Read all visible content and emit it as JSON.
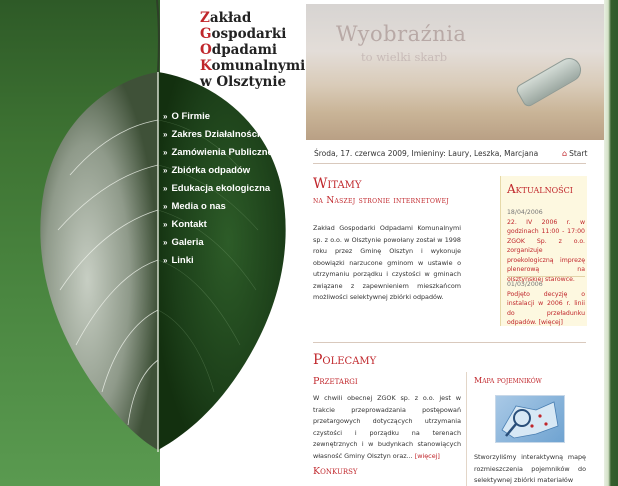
{
  "logo": {
    "lines": [
      {
        "cap": "Z",
        "rest": "akład"
      },
      {
        "cap": "G",
        "rest": "ospodarki"
      },
      {
        "cap": "O",
        "rest": "dpadami"
      },
      {
        "cap": "K",
        "rest": "omunalnymi"
      },
      {
        "cap": "",
        "rest": "w Olsztynie"
      }
    ]
  },
  "nav": {
    "items": [
      {
        "label": "O Firmie"
      },
      {
        "label": "Zakres Działalności"
      },
      {
        "label": "Zamówienia Publiczne"
      },
      {
        "label": "Zbiórka odpadów"
      },
      {
        "label": "Edukacja ekologiczna"
      },
      {
        "label": "Media o nas"
      },
      {
        "label": "Kontakt"
      },
      {
        "label": "Galeria"
      },
      {
        "label": "Linki"
      }
    ]
  },
  "header": {
    "title": "Wyobraźnia",
    "subtitle": "to wielki skarb"
  },
  "datebar": {
    "text": "Środa, 17. czerwca 2009, Imieniny: Laury, Leszka, Marcjana",
    "start": "Start"
  },
  "welcome": {
    "title": "Witamy",
    "subtitle": "na Naszej stronie internetowej",
    "body": "Zakład Gospodarki Odpadami Komunalnymi sp. z o.o. w Olsztynie powołany został w 1998 roku przez Gminę Olsztyn i wykonuje obowiązki narzucone gminom w ustawie o utrzymaniu porządku i czystości w gminach związane z zapewnieniem mieszkańcom możliwości selektywnej zbiórki odpadów."
  },
  "news": {
    "title": "Aktualności",
    "items": [
      {
        "date": "18/04/2006",
        "text": "22. IV 2006 r. w godzinach 11:00 - 17:00 ZGOK Sp. z o.o. zorganizuje proekologiczną imprezę plenerową na olsztyńskiej starówce."
      },
      {
        "date": "01/03/2006",
        "text": "Podjęto decyzję o instalacji w 2006 r. linii do przeładunku odpadów.",
        "more": "[więcej]"
      }
    ]
  },
  "recommend": {
    "title": "Polecamy",
    "tenders": {
      "title": "Przetargi",
      "body": "W chwili obecnej ZGOK sp. z o.o. jest w trakcie przeprowadzania postępowań przetargowych dotyczących utrzymania czystości i porządku na terenach zewnętrznych i w budynkach stanowiących własność Gminy Olsztyn oraz...",
      "more": "[więcej]"
    },
    "contests": {
      "title": "Konkursy"
    },
    "map": {
      "title": "Mapa pojemników",
      "body": "Stworzyliśmy interaktywną mapę rozmieszczenia pojemników do selektywnej zbiórki materiałów"
    }
  },
  "colors": {
    "accent": "#c0262b",
    "green": "#2f5a2b"
  }
}
